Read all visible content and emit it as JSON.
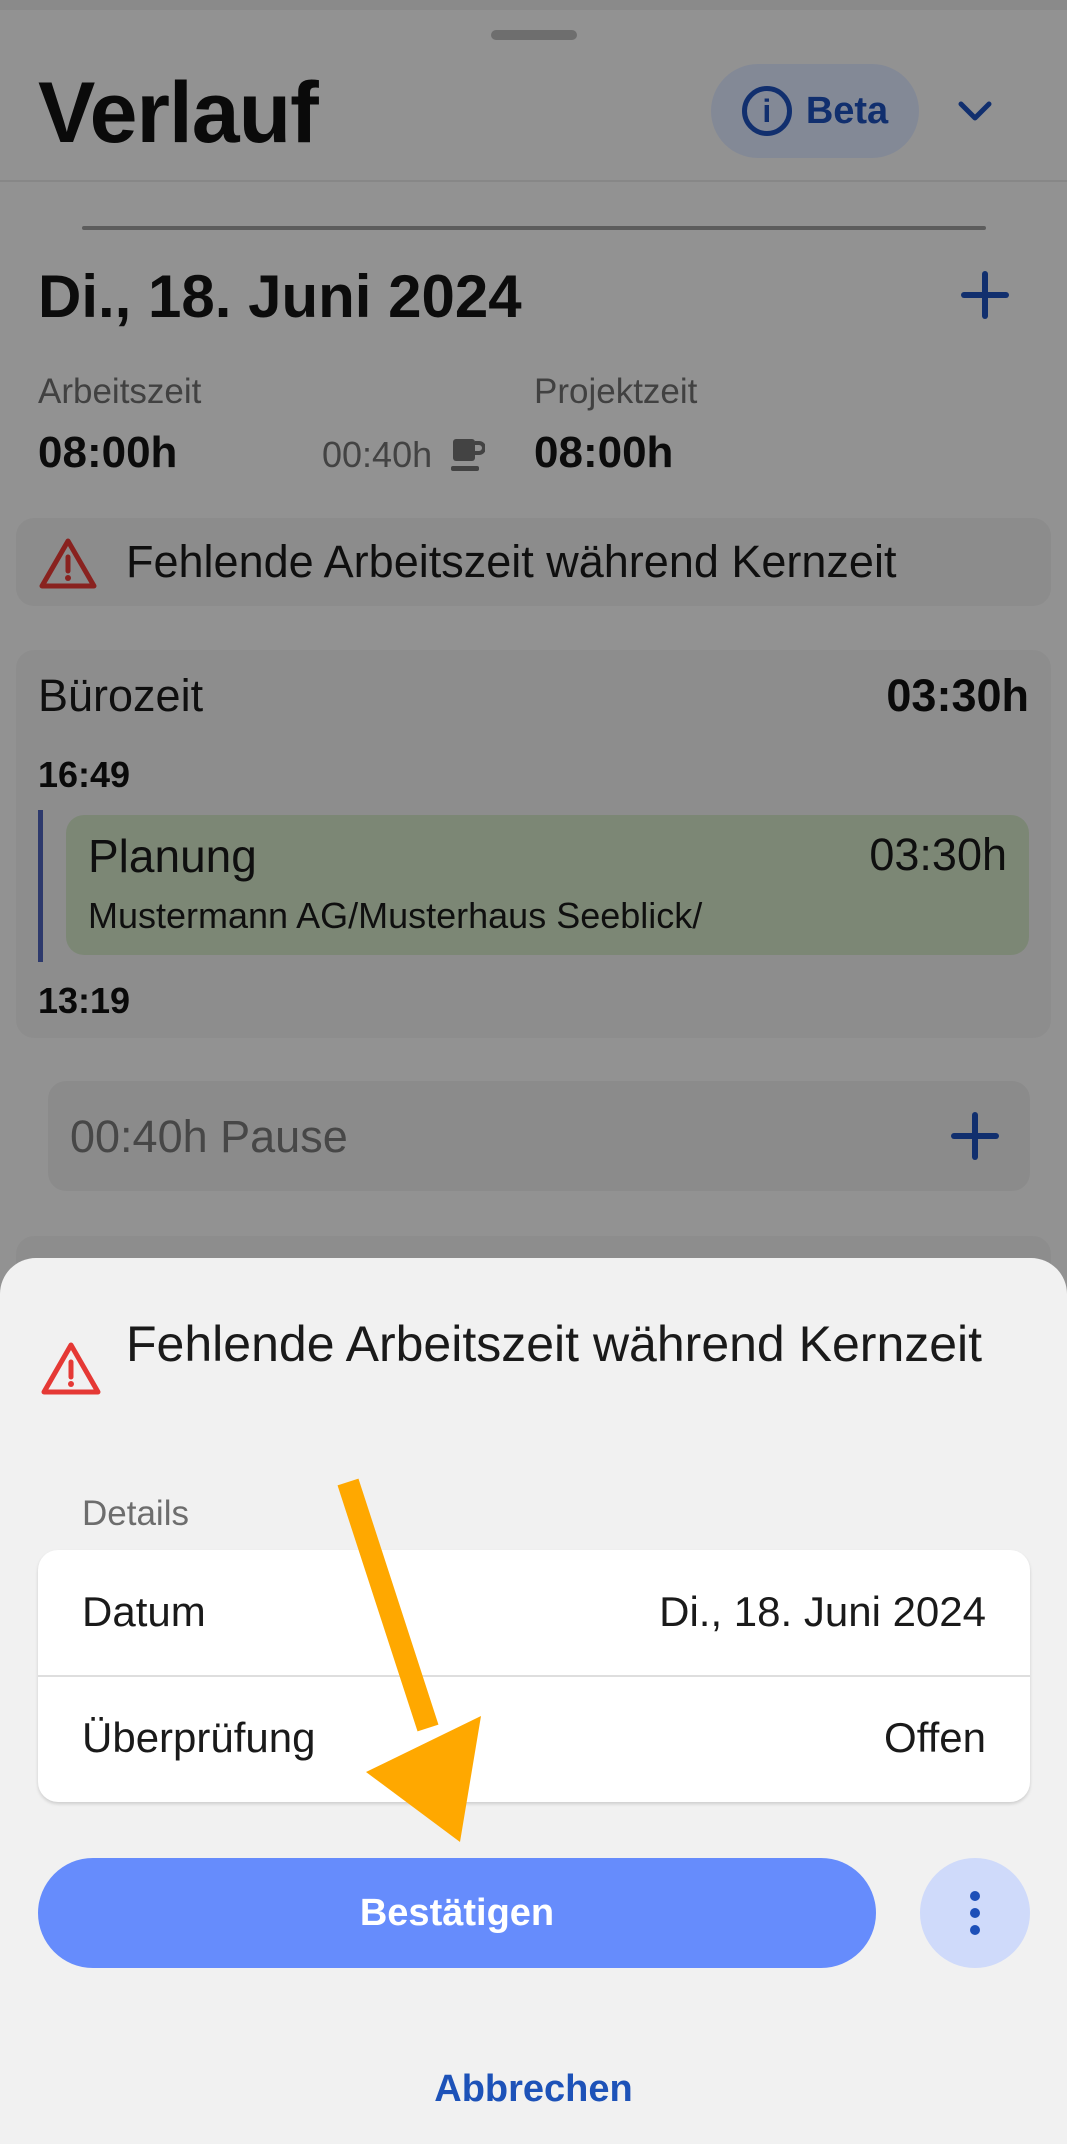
{
  "header": {
    "title": "Verlauf",
    "beta_label": "Beta",
    "info_glyph": "i"
  },
  "day": {
    "date_title": "Di., 18. Juni 2024",
    "worktime_label": "Arbeitszeit",
    "worktime_value": "08:00h",
    "break_value": "00:40h",
    "projecttime_label": "Projektzeit",
    "projecttime_value": "08:00h",
    "warning_text": "Fehlende Arbeitszeit während Kernzeit"
  },
  "office_card": {
    "title": "Bürozeit",
    "total": "03:30h",
    "end_time": "16:49",
    "start_time": "13:19",
    "task": {
      "name": "Planung",
      "duration": "03:30h",
      "path": "Mustermann AG/Musterhaus Seeblick/"
    }
  },
  "pause_row": {
    "text": "00:40h Pause"
  },
  "sheet": {
    "title": "Fehlende Arbeitszeit während Kernzeit",
    "details_label": "Details",
    "rows": [
      {
        "key": "Datum",
        "value": "Di., 18. Juni 2024"
      },
      {
        "key": "Überprüfung",
        "value": "Offen"
      }
    ],
    "confirm_label": "Bestätigen",
    "cancel_label": "Abbrechen"
  },
  "colors": {
    "accent": "#668cfc",
    "link": "#1d52b8",
    "warning": "#e53935",
    "annotation_arrow": "#ffa800"
  }
}
